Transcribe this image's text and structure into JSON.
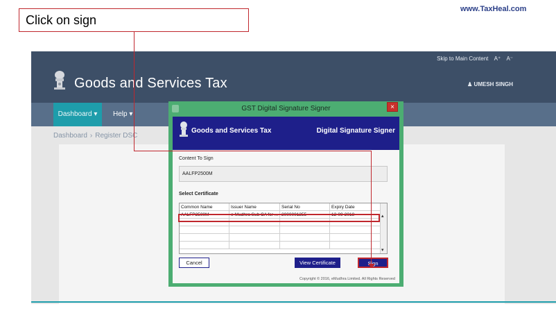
{
  "annotation": {
    "callout_text": "Click on sign",
    "watermark": "www.TaxHeal.com"
  },
  "portal": {
    "skip_link": "Skip to Main Content",
    "font_increase": "A⁺",
    "font_decrease": "A⁻",
    "title": "Goods and Services Tax",
    "user": "♟ UMESH SINGH",
    "nav": {
      "dashboard": "Dashboard ▾",
      "help": "Help ▾"
    },
    "breadcrumb": {
      "dashboard": "Dashboard",
      "separator": "›",
      "current": "Register DSC"
    }
  },
  "dialog": {
    "window_title": "GST Digital Signature Signer",
    "close_glyph": "×",
    "header_left": "Goods and Services Tax",
    "header_right": "Digital Signature Signer",
    "content_label": "Content To Sign",
    "content_value": "AALFP2500M",
    "select_label": "Select Certificate",
    "columns": [
      "Common Name",
      "Issuer Name",
      "Serial No",
      "Expiry Date"
    ],
    "rows": [
      [
        "AALFP2500M",
        "e-Mudhra Sub CA for ...",
        "2000001255",
        "12-09-2018"
      ]
    ],
    "scroll_up": "▴",
    "scroll_down": "▾",
    "cancel_label": "Cancel",
    "view_label": "View Certificate",
    "sign_label": "Sign",
    "footer": "Copyright © 2016, eMudhra Limited. All Rights Reserved"
  },
  "colors": {
    "portal_header": "#3d4f67",
    "portal_nav": "#586f8a",
    "teal": "#1e9dab",
    "dialog_frame": "#4cad72",
    "dialog_header": "#1e1f8a",
    "annotation_red": "#c0272d",
    "watermark": "#2b3f88"
  },
  "icons": [
    "emblem-icon",
    "user-icon",
    "dropdown-caret-icon",
    "close-icon",
    "scroll-up-icon",
    "scroll-down-icon",
    "app-icon"
  ]
}
